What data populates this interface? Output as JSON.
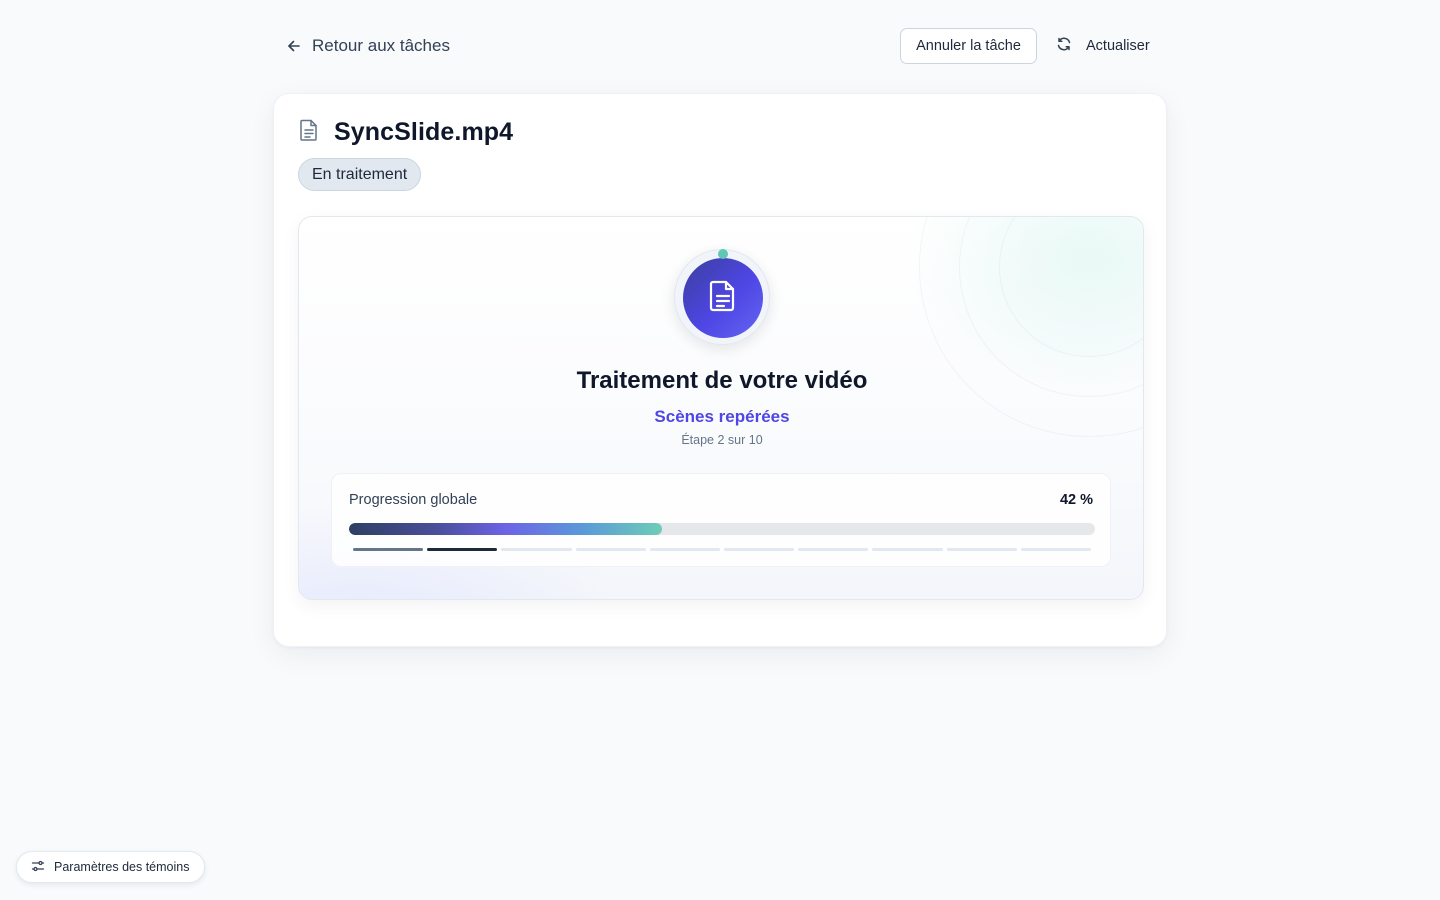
{
  "header": {
    "back_label": "Retour aux tâches",
    "cancel_label": "Annuler la tâche",
    "refresh_label": "Actualiser"
  },
  "file": {
    "name": "SyncSlide.mp4",
    "status": "En traitement",
    "icon": "document-icon"
  },
  "processing": {
    "title": "Traitement de votre vidéo",
    "current_step": "Scènes repérées",
    "step_counter": "Étape 2 sur 10",
    "step_index": 2,
    "step_total": 10
  },
  "progress": {
    "label": "Progression globale",
    "value_text": "42 %",
    "fraction": 0.42
  },
  "footer": {
    "cookie_label": "Paramètres des témoins"
  },
  "colors": {
    "accent": "#4f46e5",
    "teal": "#5ec8b5",
    "page_bg": "#f8fafc"
  }
}
